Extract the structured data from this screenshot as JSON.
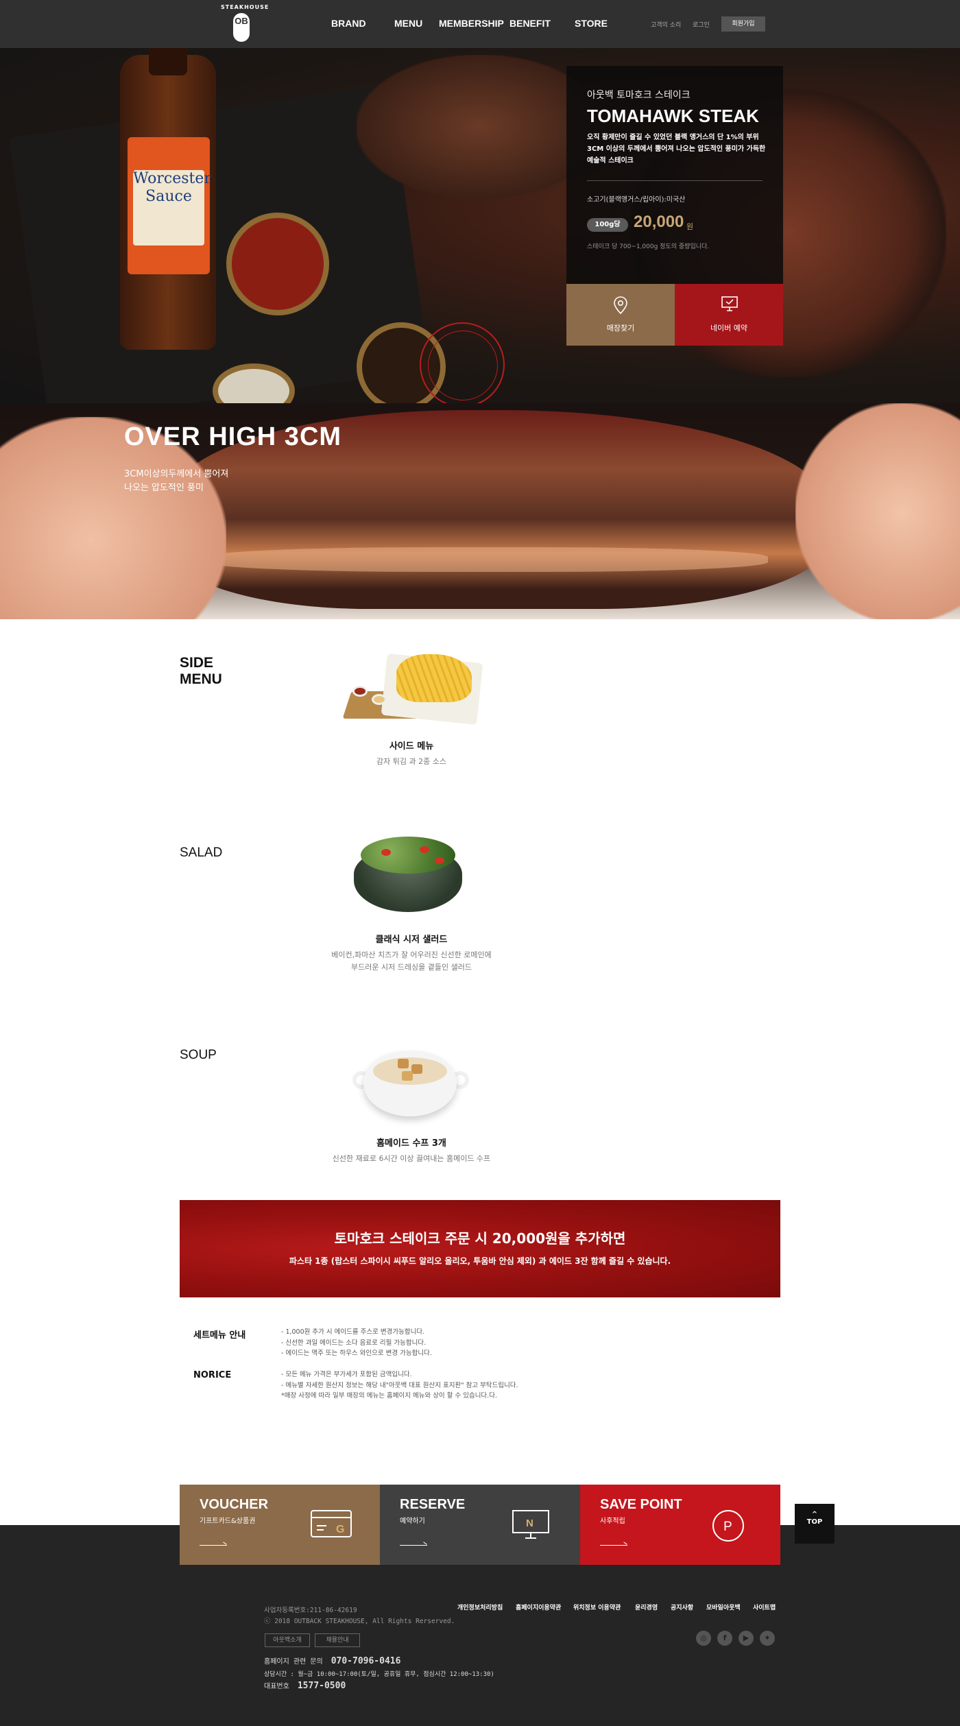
{
  "header": {
    "logo_arc": "STEAKHOUSE",
    "logo_mark": "OB",
    "nav": [
      "BRAND",
      "MENU",
      "MEMBERSHIP",
      "BENEFIT",
      "STORE"
    ],
    "util": [
      "고객의 소리",
      "로그인"
    ],
    "join": "회원가입"
  },
  "hero": {
    "label_text": "Worcester Sauce",
    "title_kr": "아웃백 토마호크 스테이크",
    "title_en": "TOMAHAWK STEAK",
    "description": "오직 황제만이 즐길 수 있었던 블랙 앵거스의 단 1%의 부위 3CM 이상의 두께에서 뿜어져 나오는 압도적인 풍미가 가득한 예술적 스테이크",
    "origin": "소고기(블랙앵거스/립아이):미국산",
    "unit": "100g당",
    "price": "20,000",
    "currency": "원",
    "note": "스테이크 당 700~1,000g 정도의 중량입니다.",
    "buttons": [
      {
        "label": "매장찾기",
        "color": "#8c6b4a",
        "icon": "map-pin-icon"
      },
      {
        "label": "네이버 예약",
        "color": "#a5161a",
        "icon": "monitor-check-icon"
      }
    ]
  },
  "over_high": {
    "title": "OVER HIGH 3CM",
    "sub_line1": "3CM이상의두께에서 뿜어져",
    "sub_line2": "나오는 압도적인 풍미"
  },
  "sections": [
    {
      "title_line1": "SIDE",
      "title_line2": "MENU",
      "item": "사이드 메뉴",
      "desc": [
        "감자 튀김 과 2종 소스"
      ]
    },
    {
      "title_line1": "SALAD",
      "title_line2": "",
      "item": "클래식 시저 샐러드",
      "desc": [
        "베이컨,파마산 치즈가 잘 어우러진 신선한 로메인에",
        "부드러운 시저 드레싱을 곁들인 샐러드"
      ]
    },
    {
      "title_line1": "SOUP",
      "title_line2": "",
      "item": "홈메이드 수프 3개",
      "desc": [
        "신선한 재료로 6시간 이상 끓여내는 홈메이드 수프"
      ]
    }
  ],
  "promo": {
    "title": "토마호크 스테이크 주문 시 20,000원을 추가하면",
    "subtitle": "파스타 1종 (랍스터 스파이시 씨푸드 알리오 올리오, 투움바 안심 제외) 과 에이드 3잔 함께 즐길 수 있습니다."
  },
  "notices": [
    {
      "heading": "세트메뉴 안내",
      "lines": [
        "- 1,000원 추가 시 에이드를 주스로 변경가능합니다.",
        "- 신선한 과일 에이드는 소다 음료로 리필 가능합니다.",
        "- 에이드는 맥주 또는 하우스 와인으로 변경 가능합니다."
      ]
    },
    {
      "heading": "NORICE",
      "lines": [
        "- 모든 메뉴 가격은 부가세가 포함된 금액입니다.",
        "- 메뉴별 자세한 원산지 정보는 해당 내\"아웃백 대표 원산지 표지판\" 참고 부탁드립니다.",
        "*매장 사정에 따라 일부 매장의 메뉴는 홈페이지 메뉴와 상이 할 수 있습니다.다."
      ]
    }
  ],
  "quick_links": [
    {
      "title": "VOUCHER",
      "sub": "기프트카드&상품권",
      "color": "#8c6b4a",
      "icon": "gift-card-icon"
    },
    {
      "title": "RESERVE",
      "sub": "예약하기",
      "color": "#404040",
      "icon": "monitor-icon"
    },
    {
      "title": "SAVE  POINT",
      "sub": "사후적립",
      "color": "#c4161c",
      "icon": "point-icon"
    }
  ],
  "top_button": "TOP",
  "footer": {
    "biz_no": "사업자등록번호:211-86-42619",
    "copyright": "ⓒ 2018 OUTBACK STEAKHOUSE, All Rights Rerserved.",
    "links": [
      "개인정보처리방침",
      "홈페이지이용약관",
      "위치정보 이용약관",
      "윤리경영",
      "공지사항",
      "모바일아웃백",
      "사이트맵"
    ],
    "buttons": [
      "아웃백소개",
      "채용안내"
    ],
    "contact_label": "홈페이지 관련 문의",
    "contact_phone": "070-7096-0416",
    "hours": "상담시간 : 월~금 10:00~17:00(토/일, 공휴일 휴무, 점심시간 12:00~13:30)",
    "rep_label": "대표번호",
    "rep_phone": "1577-0500",
    "social": [
      "instagram-icon",
      "facebook-icon",
      "youtube-icon",
      "twitter-icon"
    ]
  }
}
